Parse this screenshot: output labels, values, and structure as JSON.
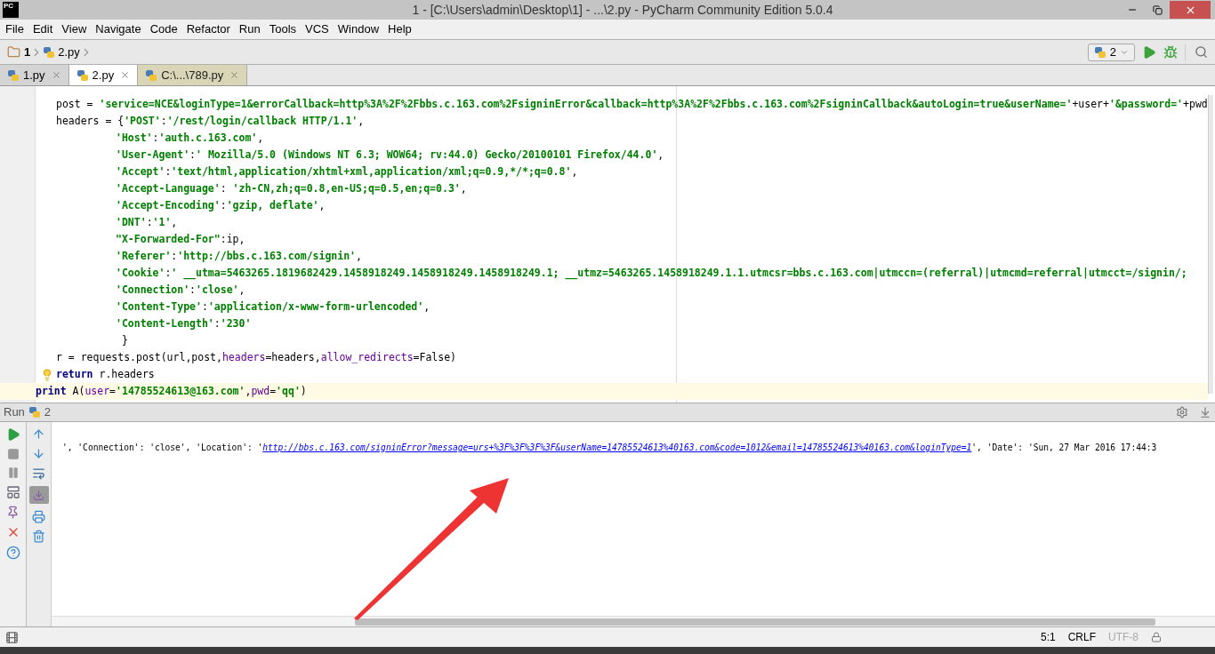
{
  "window": {
    "title": "1 - [C:\\Users\\admin\\Desktop\\1] - ...\\2.py - PyCharm Community Edition 5.0.4",
    "app_badge": "PC"
  },
  "menu": [
    "File",
    "Edit",
    "View",
    "Navigate",
    "Code",
    "Refactor",
    "Run",
    "Tools",
    "VCS",
    "Window",
    "Help"
  ],
  "breadcrumb": [
    "1",
    "2.py"
  ],
  "run_config": "2",
  "tabs": [
    {
      "label": "1.py",
      "selected": false,
      "external": false
    },
    {
      "label": "2.py",
      "selected": true,
      "external": false
    },
    {
      "label": "C:\\...\\789.py",
      "selected": false,
      "external": true
    }
  ],
  "code_lines": [
    {
      "kind": "stmt",
      "current": false,
      "segments": [
        {
          "kind": "plain",
          "text": "post = "
        },
        {
          "kind": "str",
          "text": "'service=NCE&loginType=1&errorCallback=http%3A%2F%2Fbbs.c.163.com%2FsigninError&callback=http%3A%2F%2Fbbs.c.163.com%2FsigninCallback&autoLogin=true&userName='"
        },
        {
          "kind": "plain",
          "text": "+user+"
        },
        {
          "kind": "str",
          "text": "'&password='"
        },
        {
          "kind": "plain",
          "text": "+pwd"
        }
      ]
    },
    {
      "kind": "stmt",
      "current": false,
      "segments": [
        {
          "kind": "plain",
          "text": "headers = {"
        },
        {
          "kind": "str",
          "text": "'POST'"
        },
        {
          "kind": "plain",
          "text": ":"
        },
        {
          "kind": "str",
          "text": "'/rest/login/callback HTTP/1.1'"
        },
        {
          "kind": "plain",
          "text": ","
        }
      ]
    },
    {
      "kind": "entry",
      "current": false,
      "segments": [
        {
          "kind": "str",
          "text": "'Host'"
        },
        {
          "kind": "plain",
          "text": ":"
        },
        {
          "kind": "str",
          "text": "'auth.c.163.com'"
        },
        {
          "kind": "plain",
          "text": ","
        }
      ]
    },
    {
      "kind": "entry",
      "current": false,
      "segments": [
        {
          "kind": "str",
          "text": "'User-Agent'"
        },
        {
          "kind": "plain",
          "text": ":"
        },
        {
          "kind": "str",
          "text": "' Mozilla/5.0 (Windows NT 6.3; WOW64; rv:44.0) Gecko/20100101 Firefox/44.0'"
        },
        {
          "kind": "plain",
          "text": ","
        }
      ]
    },
    {
      "kind": "entry",
      "current": false,
      "segments": [
        {
          "kind": "str",
          "text": "'Accept'"
        },
        {
          "kind": "plain",
          "text": ":"
        },
        {
          "kind": "str",
          "text": "'text/html,application/xhtml+xml,application/xml;q=0.9,*/*;q=0.8'"
        },
        {
          "kind": "plain",
          "text": ","
        }
      ]
    },
    {
      "kind": "entry",
      "current": false,
      "segments": [
        {
          "kind": "str",
          "text": "'Accept-Language'"
        },
        {
          "kind": "plain",
          "text": ": "
        },
        {
          "kind": "str",
          "text": "'zh-CN,zh;q=0.8,en-US;q=0.5,en;q=0.3'"
        },
        {
          "kind": "plain",
          "text": ","
        }
      ]
    },
    {
      "kind": "entry",
      "current": false,
      "segments": [
        {
          "kind": "str",
          "text": "'Accept-Encoding'"
        },
        {
          "kind": "plain",
          "text": ":"
        },
        {
          "kind": "str",
          "text": "'gzip, deflate'"
        },
        {
          "kind": "plain",
          "text": ","
        }
      ]
    },
    {
      "kind": "entry",
      "current": false,
      "segments": [
        {
          "kind": "str",
          "text": "'DNT'"
        },
        {
          "kind": "plain",
          "text": ":"
        },
        {
          "kind": "str",
          "text": "'1'"
        },
        {
          "kind": "plain",
          "text": ","
        }
      ]
    },
    {
      "kind": "entry",
      "current": false,
      "segments": [
        {
          "kind": "str",
          "text": "\"X-Forwarded-For\""
        },
        {
          "kind": "plain",
          "text": ":ip,"
        }
      ]
    },
    {
      "kind": "entry",
      "current": false,
      "segments": [
        {
          "kind": "str",
          "text": "'Referer'"
        },
        {
          "kind": "plain",
          "text": ":"
        },
        {
          "kind": "str",
          "text": "'http://bbs.c.163.com/signin'"
        },
        {
          "kind": "plain",
          "text": ","
        }
      ]
    },
    {
      "kind": "entry",
      "current": false,
      "segments": [
        {
          "kind": "str",
          "text": "'Cookie'"
        },
        {
          "kind": "plain",
          "text": ":"
        },
        {
          "kind": "str",
          "text": "' __utma=5463265.1819682429.1458918249.1458918249.1458918249.1; __utmz=5463265.1458918249.1.1.utmcsr=bbs.c.163.com|utmccn=(referral)|utmcmd=referral|utmcct=/signin/;"
        }
      ]
    },
    {
      "kind": "entry",
      "current": false,
      "segments": [
        {
          "kind": "str",
          "text": "'Connection'"
        },
        {
          "kind": "plain",
          "text": ":"
        },
        {
          "kind": "str",
          "text": "'close'"
        },
        {
          "kind": "plain",
          "text": ","
        }
      ]
    },
    {
      "kind": "entry",
      "current": false,
      "segments": [
        {
          "kind": "str",
          "text": "'Content-Type'"
        },
        {
          "kind": "plain",
          "text": ":"
        },
        {
          "kind": "str",
          "text": "'application/x-www-form-urlencoded'"
        },
        {
          "kind": "plain",
          "text": ","
        }
      ]
    },
    {
      "kind": "entry",
      "current": false,
      "segments": [
        {
          "kind": "str",
          "text": "'Content-Length'"
        },
        {
          "kind": "plain",
          "text": ":"
        },
        {
          "kind": "str",
          "text": "'230'"
        }
      ]
    },
    {
      "kind": "close",
      "current": false,
      "segments": [
        {
          "kind": "plain",
          "text": "}"
        }
      ]
    },
    {
      "kind": "stmt",
      "current": false,
      "segments": [
        {
          "kind": "plain",
          "text": "r = requests.post(url,post,"
        },
        {
          "kind": "param",
          "text": "headers"
        },
        {
          "kind": "plain",
          "text": "=headers,"
        },
        {
          "kind": "param",
          "text": "allow_redirects"
        },
        {
          "kind": "plain",
          "text": "=False)"
        }
      ]
    },
    {
      "kind": "stmt",
      "current": false,
      "bulb": true,
      "segments": [
        {
          "kind": "keyword",
          "text": "return"
        },
        {
          "kind": "plain",
          "text": " r.headers"
        }
      ]
    },
    {
      "kind": "top",
      "current": true,
      "segments": [
        {
          "kind": "keyword",
          "text": "print"
        },
        {
          "kind": "plain",
          "text": " A("
        },
        {
          "kind": "param",
          "text": "user"
        },
        {
          "kind": "plain",
          "text": "="
        },
        {
          "kind": "str",
          "text": "'14785524613@163.com'"
        },
        {
          "kind": "plain",
          "text": ","
        },
        {
          "kind": "param",
          "text": "pwd"
        },
        {
          "kind": "plain",
          "text": "="
        },
        {
          "kind": "str",
          "text": "'qq'"
        },
        {
          "kind": "plain",
          "text": ")"
        }
      ]
    }
  ],
  "run_panel": {
    "label": "Run",
    "config": "2",
    "output": [
      {
        "kind": "plain",
        "text": "', 'Connection': 'close', 'Location': '"
      },
      {
        "kind": "link",
        "text": "http://bbs.c.163.com/signinError?message=urs+%3F%3F%3F%3F&userName=14785524613%40163.com&code=1012&email=14785524613%40163.com&loginType=1"
      },
      {
        "kind": "plain",
        "text": "', 'Date': 'Sun, 27 Mar 2016 17:44:3"
      }
    ]
  },
  "status_bar": {
    "position": "5:1",
    "line_separator": "CRLF",
    "encoding": "UTF-8"
  }
}
